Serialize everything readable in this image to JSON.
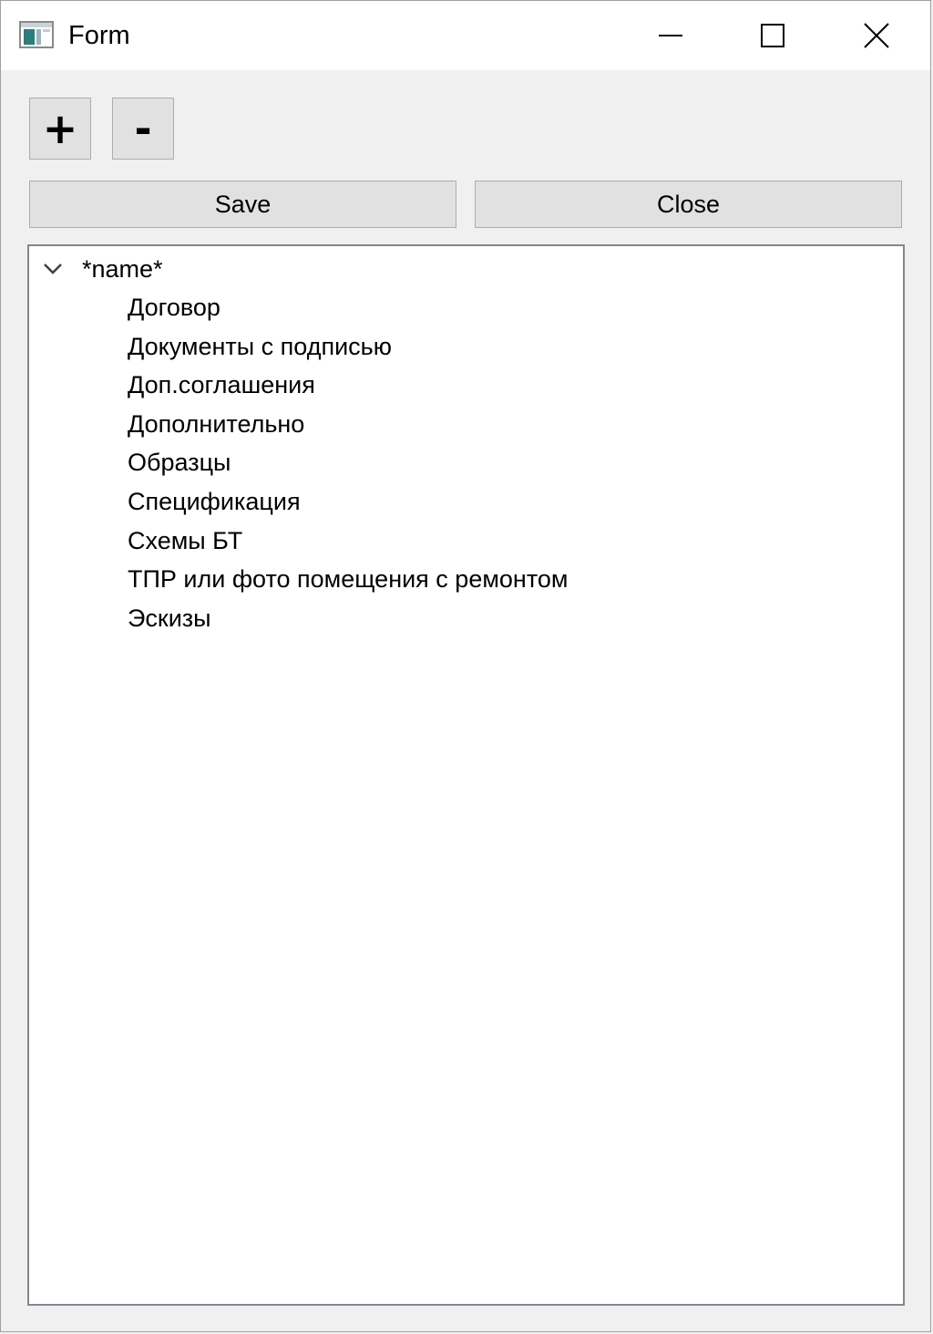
{
  "window": {
    "title": "Form",
    "icon": "form-app-icon",
    "controls": {
      "minimize_icon": "minimize-icon",
      "maximize_icon": "maximize-icon",
      "close_icon": "close-icon"
    }
  },
  "toolbar": {
    "add_label": "+",
    "remove_label": "-",
    "save_label": "Save",
    "close_label": "Close"
  },
  "tree": {
    "root": {
      "label": "*name*",
      "expanded": true,
      "children": [
        "Договор",
        "Документы с подписью",
        "Доп.соглашения",
        "Дополнительно",
        "Образцы",
        "Спецификация",
        "Схемы БТ",
        "ТПР или фото помещения с ремонтом",
        "Эскизы"
      ]
    }
  },
  "colors": {
    "window_bg": "#f0f0f0",
    "titlebar_bg": "#ffffff",
    "button_bg": "#e1e1e1",
    "button_border": "#adadad",
    "tree_border": "#828790"
  }
}
